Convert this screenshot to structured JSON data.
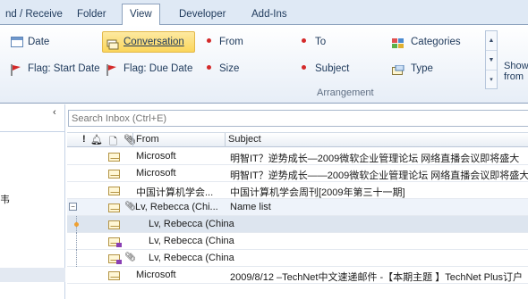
{
  "tabs": [
    "nd / Receive",
    "Folder",
    "View",
    "Developer",
    "Add-Ins"
  ],
  "active_tab": "View",
  "arrangement": {
    "group_label": "Arrangement",
    "items": [
      {
        "label": "Date",
        "icon": "calendar-icon"
      },
      {
        "label": "Conversation",
        "icon": "conversation-icon",
        "selected": true
      },
      {
        "label": "From",
        "icon": "red-dot-icon"
      },
      {
        "label": "To",
        "icon": "red-dot-icon"
      },
      {
        "label": "Categories",
        "icon": "categories-icon"
      },
      {
        "label": "Flag: Start Date",
        "icon": "flag-icon"
      },
      {
        "label": "Flag: Due Date",
        "icon": "flag-icon"
      },
      {
        "label": "Size",
        "icon": "red-dot-icon"
      },
      {
        "label": "Subject",
        "icon": "red-dot-icon"
      },
      {
        "label": "Type",
        "icon": "type-icon"
      }
    ],
    "show_from": "Show\nfrom"
  },
  "nav": {
    "collapse_glyph": "‹",
    "fragment": "韦"
  },
  "search": {
    "placeholder": "Search Inbox (Ctrl+E)"
  },
  "columns": {
    "from": "From",
    "subject": "Subject"
  },
  "rows": [
    {
      "from": "Microsoft",
      "subject": "明智IT？逆势成长—2009微软企业管理论坛 网络直播会议即将盛大"
    },
    {
      "from": "Microsoft",
      "subject": "明智IT？逆势成长——2009微软企业管理论坛 网络直播会议即将盛大"
    },
    {
      "from": "中国计算机学会...",
      "subject": "中国计算机学会周刊[2009年第三十一期]"
    },
    {
      "from": "Lv, Rebecca  (Chi...",
      "subject": "Name list",
      "group": true
    },
    {
      "from": "Lv, Rebecca  (China)",
      "subject": "",
      "sub": true
    },
    {
      "from": "Lv, Rebecca  (China)",
      "subject": "",
      "sub": true
    },
    {
      "from": "Lv, Rebecca  (China)",
      "subject": "",
      "sub": true
    },
    {
      "from": "Microsoft",
      "subject": "2009/8/12 –TechNet中文速递邮件 -【本期主题 】TechNet Plus订户"
    }
  ],
  "colors": {
    "ribbon_bg": "#dfe9f5",
    "selected_highlight": "#fbd65b",
    "accent": "#1e395b"
  }
}
